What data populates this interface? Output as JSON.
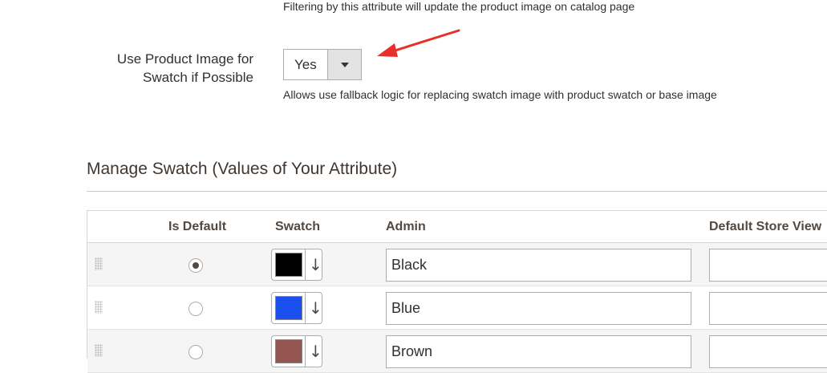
{
  "filter_note": "Filtering by this attribute will update the product image on catalog page",
  "use_product_image": {
    "label": "Use Product Image for Swatch if Possible",
    "selected": "Yes",
    "note": "Allows use fallback logic for replacing swatch image with product swatch or base image"
  },
  "section_title": "Manage Swatch (Values of Your Attribute)",
  "table": {
    "headers": {
      "is_default": "Is Default",
      "swatch": "Swatch",
      "admin": "Admin",
      "default_store_view": "Default Store View"
    },
    "rows": [
      {
        "is_default": true,
        "swatch_color": "#000000",
        "admin": "Black",
        "store_view": ""
      },
      {
        "is_default": false,
        "swatch_color": "#1c4ff0",
        "admin": "Blue",
        "store_view": ""
      },
      {
        "is_default": false,
        "swatch_color": "#955550",
        "admin": "Brown",
        "store_view": ""
      }
    ]
  },
  "icons": {
    "caret": "caret-down-icon",
    "swatch_arrow": "down-arrow-icon",
    "drag": "drag-handle-icon",
    "annotation": "red-arrow-annotation"
  },
  "colors": {
    "annotation_arrow": "#e8302a"
  }
}
